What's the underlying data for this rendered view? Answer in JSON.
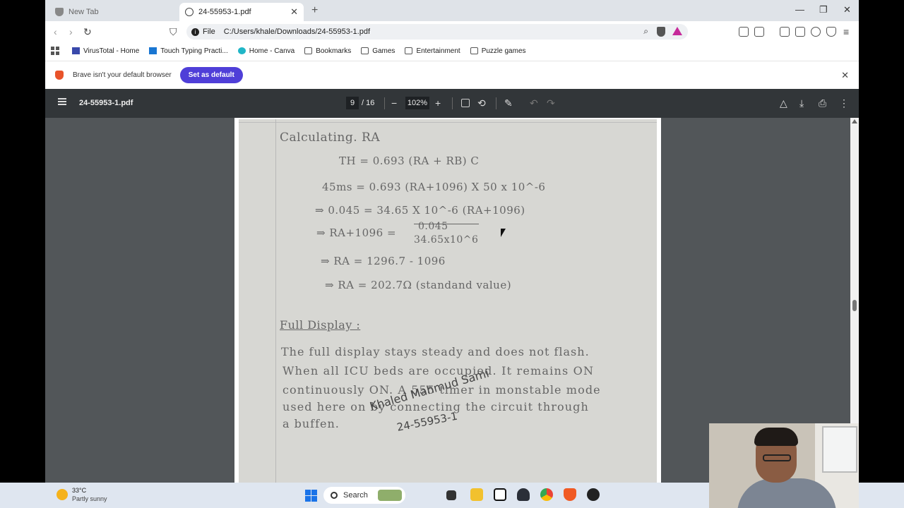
{
  "browser": {
    "tabs": [
      {
        "title": "New Tab",
        "active": false
      },
      {
        "title": "24-55953-1.pdf",
        "active": true
      }
    ],
    "address": {
      "scheme_label": "File",
      "url": "C:/Users/khale/Downloads/24-55953-1.pdf"
    },
    "bookmarks": [
      {
        "label": "VirusTotal - Home",
        "icon": "virustotal-icon"
      },
      {
        "label": "Touch Typing Practi...",
        "icon": "typing-icon"
      },
      {
        "label": "Home - Canva",
        "icon": "canva-icon"
      },
      {
        "label": "Bookmarks",
        "icon": "folder-icon"
      },
      {
        "label": "Games",
        "icon": "folder-icon"
      },
      {
        "label": "Entertainment",
        "icon": "folder-icon"
      },
      {
        "label": "Puzzle games",
        "icon": "folder-icon"
      }
    ],
    "infobar": {
      "message": "Brave isn't your default browser",
      "button": "Set as default"
    },
    "colors": {
      "accent": "#4f3fd8",
      "pdf_toolbar": "#323639",
      "viewer_bg": "#525659"
    }
  },
  "pdf": {
    "filename": "24-55953-1.pdf",
    "current_page": "9",
    "total_pages": "/ 16",
    "zoom": "102%"
  },
  "document": {
    "lines": [
      "Calculating. RA",
      "TH = 0.693 (RA + RB) C",
      "45ms = 0.693 (RA+1096) X 50 x 10^-6",
      "⇒ 0.045 = 34.65 X 10^-6 (RA+1096)",
      "⇒ RA+1096 =",
      "0.045",
      "34.65x10^6",
      "⇒ RA = 1296.7 - 1096",
      "⇒ RA = 202.7Ω (standand value)",
      "Full Display :",
      "The full display stays steady and does not flash.",
      "When all ICU beds are occupied. It remains ON",
      "continuously ON. A 555 timer in monstable mode",
      "used here on by connecting the circuit through",
      "a buffen."
    ],
    "signature": {
      "name": "Khaled Mahmud Sami",
      "id": "24-55953-1"
    }
  },
  "taskbar": {
    "weather": {
      "temp": "33°C",
      "condition": "Partly sunny"
    },
    "search_label": "Search",
    "apps": [
      "file-explorer-icon",
      "notion-icon",
      "app-icon",
      "chrome-icon",
      "brave-icon",
      "obs-icon"
    ]
  }
}
